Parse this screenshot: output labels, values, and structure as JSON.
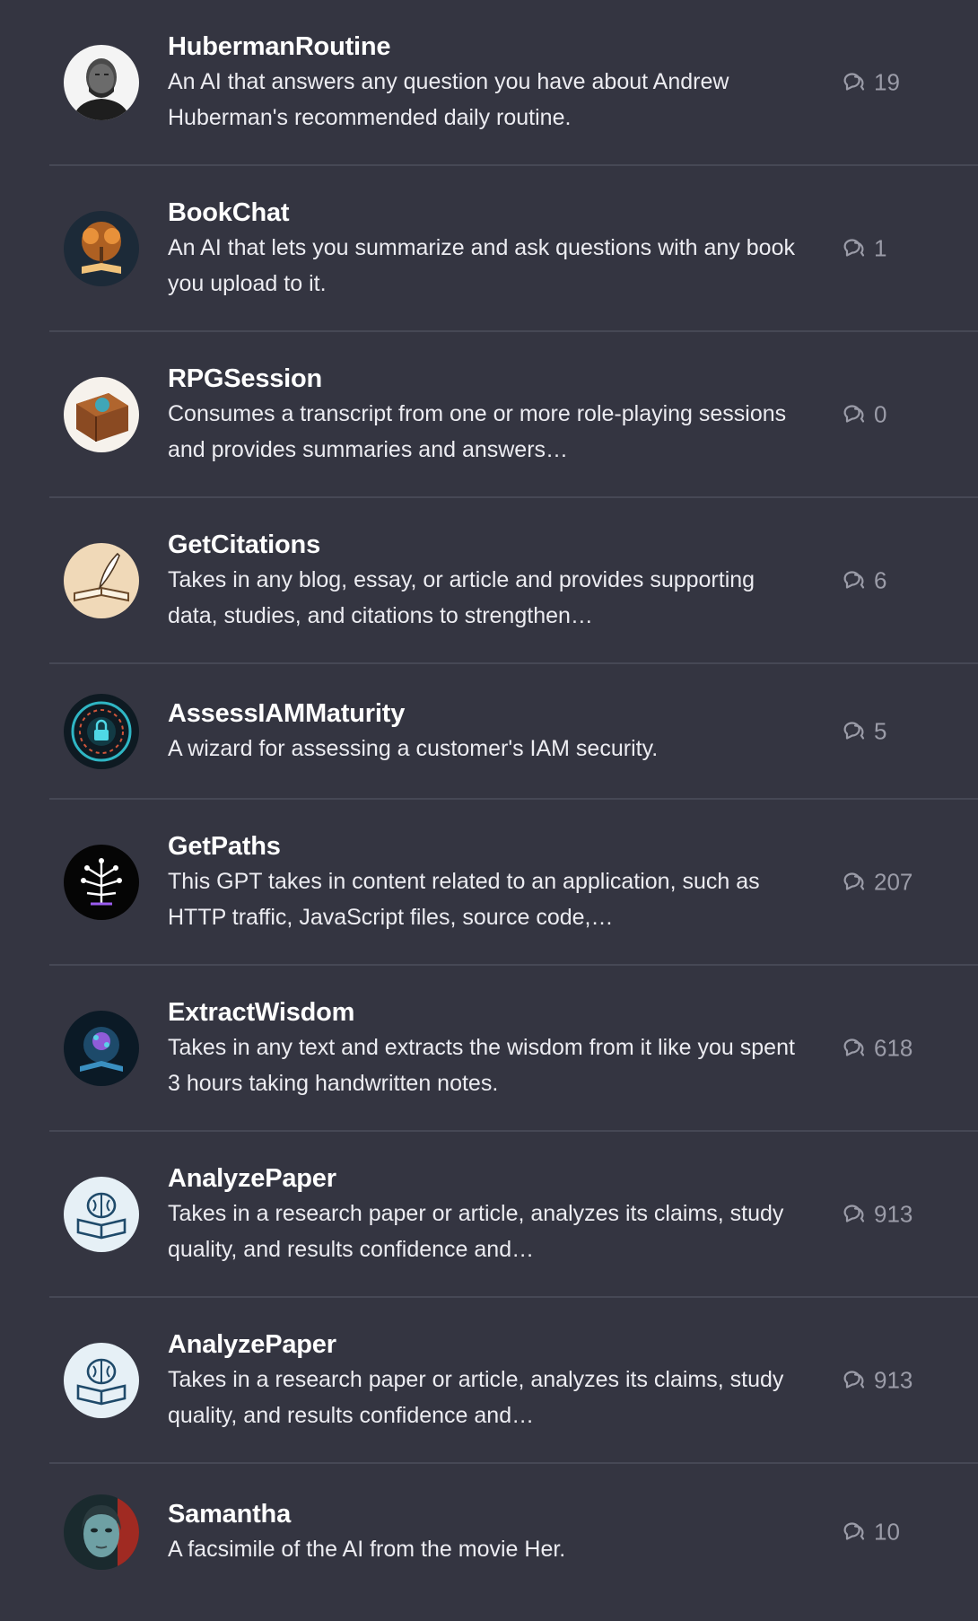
{
  "gpts": [
    {
      "name": "HubermanRoutine",
      "description": "An AI that answers any question you have about Andrew Huberman's recommended daily routine.",
      "chats": "19",
      "avatar_icon": "portrait-man-icon"
    },
    {
      "name": "BookChat",
      "description": "An AI that lets you summarize and ask questions with any book you upload to it.",
      "chats": "1",
      "avatar_icon": "glowing-tree-book-icon"
    },
    {
      "name": "RPGSession",
      "description": "Consumes a transcript from one or more role-playing sessions and provides summaries and answers…",
      "chats": "0",
      "avatar_icon": "ornate-tome-icon"
    },
    {
      "name": "GetCitations",
      "description": "Takes in any blog, essay, or article and provides supporting data, studies, and citations to strengthen…",
      "chats": "6",
      "avatar_icon": "quill-book-icon"
    },
    {
      "name": "AssessIAMMaturity",
      "description": "A wizard for assessing a customer's IAM security.",
      "chats": "5",
      "avatar_icon": "cyber-lock-icon"
    },
    {
      "name": "GetPaths",
      "description": "This GPT takes in content related to an application, such as HTTP traffic, JavaScript files, source code,…",
      "chats": "207",
      "avatar_icon": "circuit-tree-icon"
    },
    {
      "name": "ExtractWisdom",
      "description": "Takes in any text and extracts the wisdom from it like you spent 3 hours taking handwritten notes.",
      "chats": "618",
      "avatar_icon": "wisdom-book-icon"
    },
    {
      "name": "AnalyzePaper",
      "description": "Takes in a research paper or article, analyzes its claims, study quality, and results confidence and…",
      "chats": "913",
      "avatar_icon": "brain-book-icon"
    },
    {
      "name": "AnalyzePaper",
      "description": "Takes in a research paper or article, analyzes its claims, study quality, and results confidence and…",
      "chats": "913",
      "avatar_icon": "brain-book-icon"
    },
    {
      "name": "Samantha",
      "description": "A facsimile of the AI from the movie Her.",
      "chats": "10",
      "avatar_icon": "woman-face-icon"
    }
  ],
  "colors": {
    "background": "#343541",
    "divider": "#464855",
    "title": "#ffffff",
    "description": "#ececf1",
    "count": "#9b9ca8"
  },
  "icons": {
    "chat_count": "chat-bubbles-icon"
  }
}
